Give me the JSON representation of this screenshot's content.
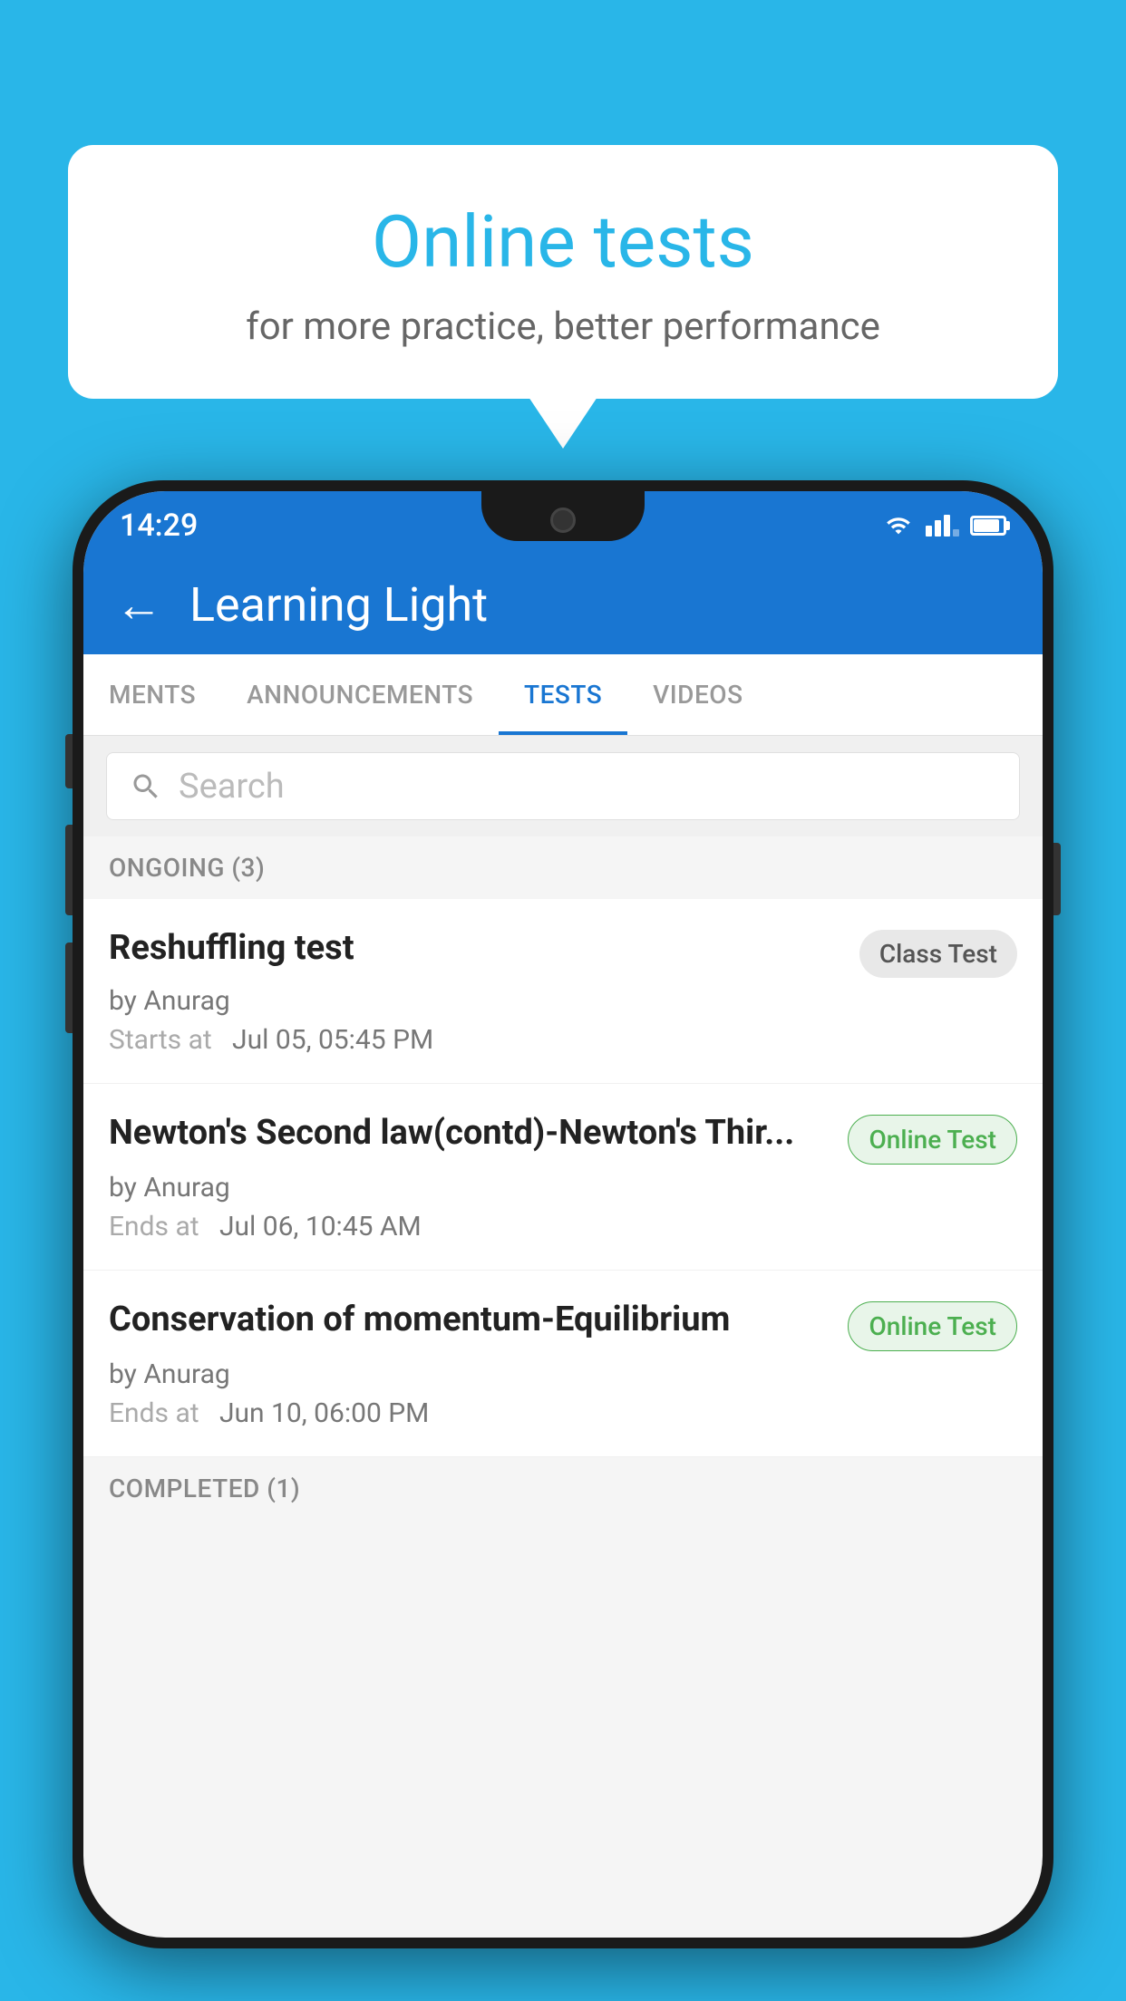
{
  "background_color": "#29B6E8",
  "speech_bubble": {
    "title": "Online tests",
    "subtitle": "for more practice, better performance"
  },
  "status_bar": {
    "time": "14:29",
    "wifi": true,
    "signal": true,
    "battery": true
  },
  "app_header": {
    "title": "Learning Light",
    "back_label": "←"
  },
  "tabs": [
    {
      "label": "MENTS",
      "active": false
    },
    {
      "label": "ANNOUNCEMENTS",
      "active": false
    },
    {
      "label": "TESTS",
      "active": true
    },
    {
      "label": "VIDEOS",
      "active": false
    }
  ],
  "search": {
    "placeholder": "Search"
  },
  "sections": [
    {
      "label": "ONGOING (3)",
      "tests": [
        {
          "name": "Reshuffling test",
          "badge": "Class Test",
          "badge_type": "class",
          "author": "by Anurag",
          "date_label": "Starts at",
          "date": "Jul 05, 05:45 PM"
        },
        {
          "name": "Newton's Second law(contd)-Newton's Thir...",
          "badge": "Online Test",
          "badge_type": "online",
          "author": "by Anurag",
          "date_label": "Ends at",
          "date": "Jul 06, 10:45 AM"
        },
        {
          "name": "Conservation of momentum-Equilibrium",
          "badge": "Online Test",
          "badge_type": "online",
          "author": "by Anurag",
          "date_label": "Ends at",
          "date": "Jun 10, 06:00 PM"
        }
      ]
    }
  ],
  "completed_section": {
    "label": "COMPLETED (1)"
  }
}
